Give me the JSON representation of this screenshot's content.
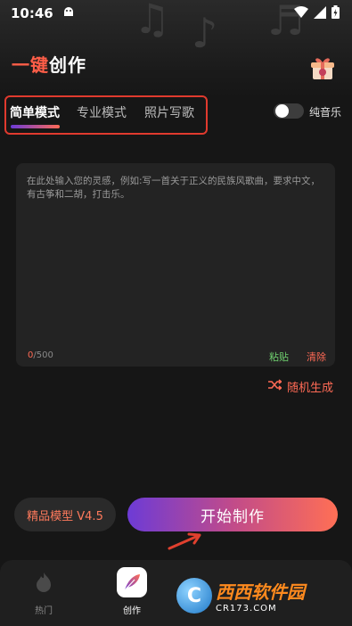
{
  "status": {
    "time": "10:46"
  },
  "header": {
    "title_accent": "一键",
    "title_rest": "创作"
  },
  "tabs": [
    {
      "label": "简单模式",
      "active": true
    },
    {
      "label": "专业模式",
      "active": false
    },
    {
      "label": "照片写歌",
      "active": false
    }
  ],
  "toggle": {
    "label": "纯音乐",
    "on": false
  },
  "input": {
    "placeholder": "在此处输入您的灵感，例如:写一首关于正义的民族风歌曲，要求中文，有古筝和二胡，打击乐。",
    "count_current": "0",
    "count_max": "/500",
    "paste_label": "粘贴",
    "clear_label": "清除"
  },
  "random": {
    "label": "随机生成"
  },
  "model": {
    "label": "精品模型 V4.5"
  },
  "start_button": {
    "label": "开始制作"
  },
  "nav": [
    {
      "label": "热门",
      "icon": "flame-icon",
      "active": false
    },
    {
      "label": "创作",
      "icon": "feather-icon",
      "active": true
    }
  ],
  "watermark": {
    "title": "西西软件园",
    "sub": "CR173.COM"
  },
  "colors": {
    "accent": "#ff5e48",
    "gradient_start": "#6d3bd6",
    "gradient_end": "#ff6f55",
    "background": "#161616"
  }
}
